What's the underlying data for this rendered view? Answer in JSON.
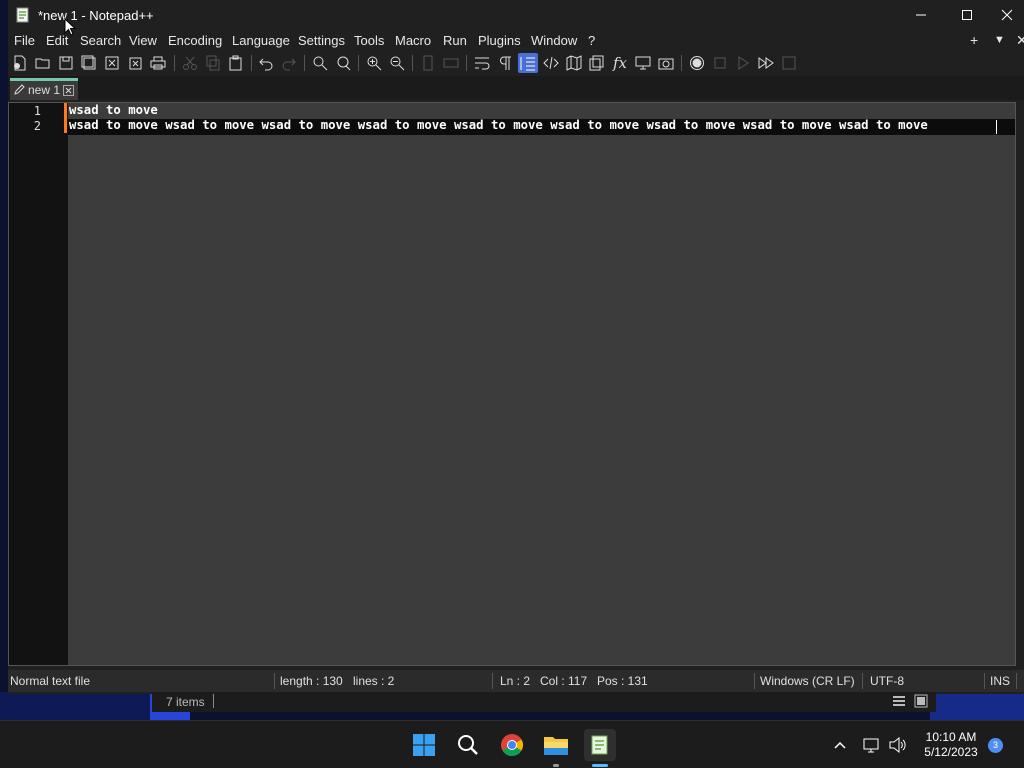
{
  "window": {
    "title": "*new 1 - Notepad++"
  },
  "menu": {
    "items": [
      "File",
      "Edit",
      "Search",
      "View",
      "Encoding",
      "Language",
      "Settings",
      "Tools",
      "Macro",
      "Run",
      "Plugins",
      "Window",
      "?"
    ],
    "right_icons": [
      "plus-icon",
      "dropdown-arrow-icon",
      "close-icon"
    ]
  },
  "tab": {
    "label": "new 1"
  },
  "editor": {
    "line_numbers": [
      "1",
      "2"
    ],
    "lines": [
      "wsad to move",
      "wsad to move wsad to move wsad to move wsad to move wsad to move wsad to move wsad to move wsad to move wsad to move"
    ]
  },
  "status": {
    "file_type": "Normal text file",
    "length": "length : 130",
    "lines": "lines : 2",
    "ln": "Ln : 2",
    "col": "Col : 117",
    "pos": "Pos : 131",
    "eol": "Windows (CR LF)",
    "encoding": "UTF-8",
    "mode": "INS"
  },
  "explorer": {
    "items_count": "7 items"
  },
  "taskbar": {
    "time": "10:10 AM",
    "date": "5/12/2023",
    "notification_count": "3"
  },
  "colors": {
    "accent": "#4a6fd4",
    "changed_line": "#ff7a1a",
    "tab_indicator": "#78c8a8"
  }
}
